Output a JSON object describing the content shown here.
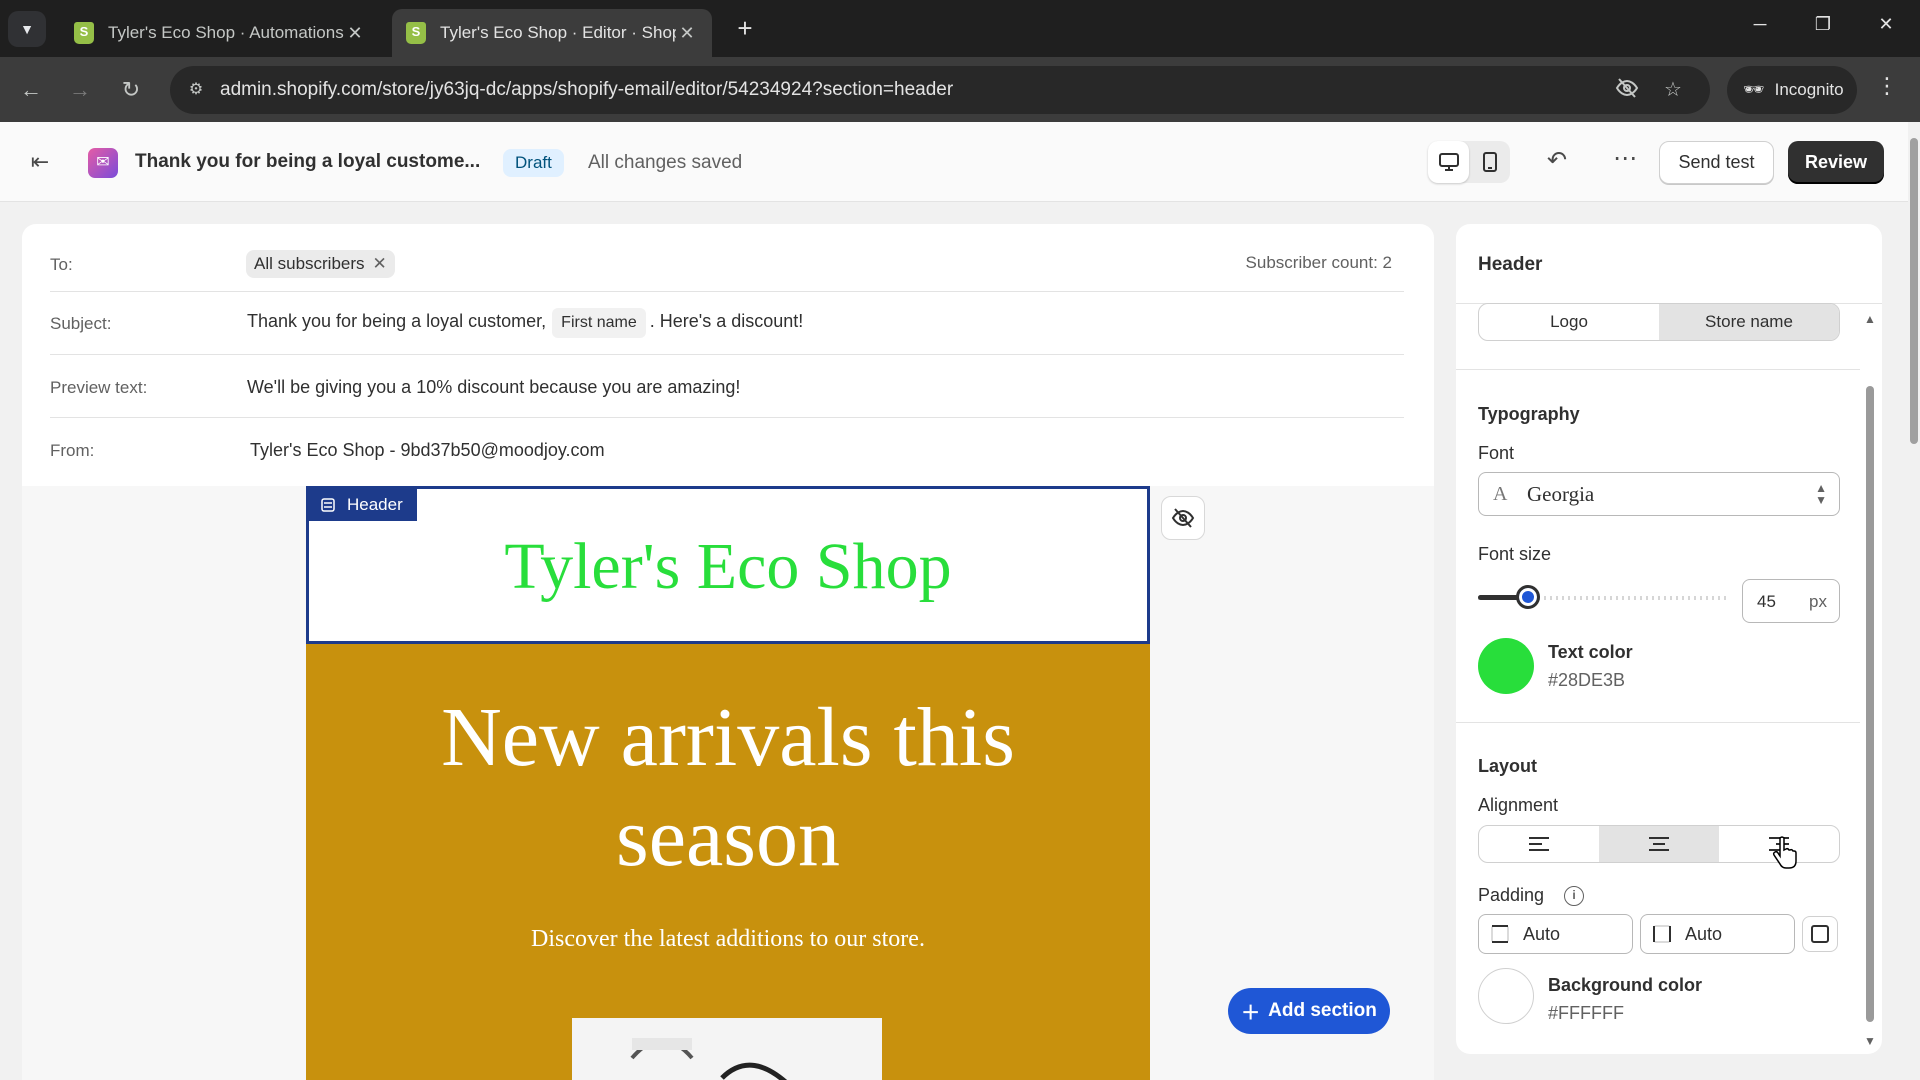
{
  "browser": {
    "tabs": [
      {
        "title": "Tyler's Eco Shop · Automations",
        "active": false
      },
      {
        "title": "Tyler's Eco Shop · Editor · Shopify",
        "active": true
      }
    ],
    "url": "admin.shopify.com/store/jy63jq-dc/apps/shopify-email/editor/54234924?section=header",
    "incognito_label": "Incognito"
  },
  "appbar": {
    "email_title": "Thank you for being a loyal custome...",
    "status_badge": "Draft",
    "save_status": "All changes saved",
    "send_test_label": "Send test",
    "review_label": "Review"
  },
  "meta": {
    "to_label": "To:",
    "to_chip": "All subscribers",
    "subscriber_count": "Subscriber count: 2",
    "subject_label": "Subject:",
    "subject_prefix": "Thank you for being a loyal customer,",
    "subject_token": "First name",
    "subject_suffix": ". Here's a discount!",
    "preview_label": "Preview text:",
    "preview_value": "We'll be giving you a 10% discount because you are amazing!",
    "from_label": "From:",
    "from_value": "Tyler's Eco Shop - 9bd37b50@moodjoy.com"
  },
  "email": {
    "header_tag": "Header",
    "store_name": "Tyler's Eco Shop",
    "store_name_color": "#28DE3B",
    "hero_title": "New arrivals this season",
    "hero_subtitle": "Discover the latest additions to our store.",
    "hero_bg": "#C8910D"
  },
  "add_section_label": "Add section",
  "panel": {
    "title": "Header",
    "header_type_options": [
      "Logo",
      "Store name"
    ],
    "header_type_selected": "Store name",
    "typography_title": "Typography",
    "font_label": "Font",
    "font_value": "Georgia",
    "font_size_label": "Font size",
    "font_size_value": "45",
    "font_size_unit": "px",
    "font_size_slider_fraction": 0.2,
    "text_color_label": "Text color",
    "text_color_hex": "#28DE3B",
    "layout_title": "Layout",
    "alignment_label": "Alignment",
    "alignment_selected": "center",
    "padding_label": "Padding",
    "padding_vertical": "Auto",
    "padding_horizontal": "Auto",
    "background_color_label": "Background color",
    "background_color_hex": "#FFFFFF"
  }
}
